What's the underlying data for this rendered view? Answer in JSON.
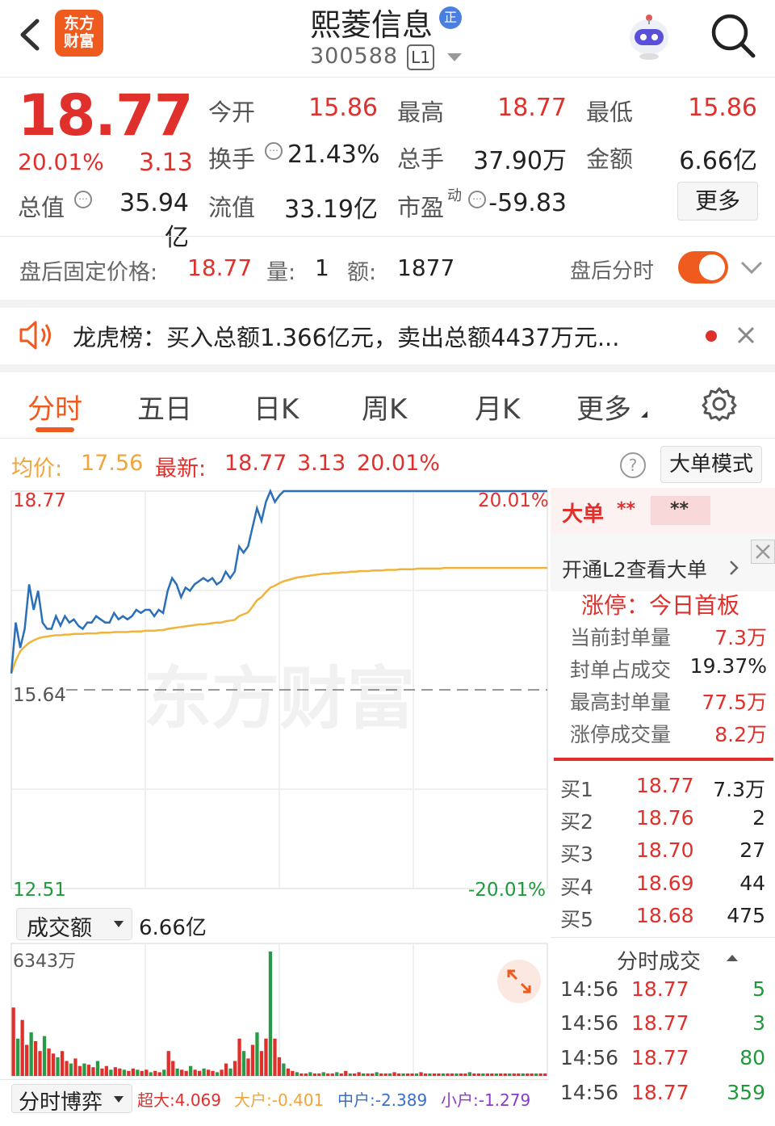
{
  "header": {
    "logo_text": "东方财富",
    "stock_name": "熙菱信息",
    "badge": "正",
    "stock_code": "300588",
    "level_badge": "L1"
  },
  "quote": {
    "price": "18.77",
    "change_pct": "20.01%",
    "change": "3.13",
    "open_label": "今开",
    "open": "15.86",
    "high_label": "最高",
    "high": "18.77",
    "low_label": "最低",
    "low": "15.86",
    "turnover_label": "换手",
    "turnover": "21.43%",
    "volume_label": "总手",
    "volume": "37.90万",
    "amount_label": "金额",
    "amount": "6.66亿",
    "mktcap_label": "总值",
    "mktcap": "35.94亿",
    "float_label": "流值",
    "float_cap": "33.19亿",
    "pe_label": "市盈",
    "pe_sup": "动",
    "pe": "-59.83",
    "more_button": "更多",
    "info_glyph": "⋯"
  },
  "after_hours": {
    "label": "盘后固定价格:",
    "price": "18.77",
    "vol_label": "量:",
    "vol": "1",
    "amt_label": "额:",
    "amt": "1877",
    "link": "盘后分时"
  },
  "dragon_tiger": {
    "text": "龙虎榜：买入总额1.366亿元，卖出总额4437万元..."
  },
  "tabs": [
    {
      "label": "分时"
    },
    {
      "label": "五日"
    },
    {
      "label": "日K"
    },
    {
      "label": "周K"
    },
    {
      "label": "月K"
    },
    {
      "label": "更多"
    }
  ],
  "avg_bar": {
    "avg_label": "均价:",
    "avg": "17.56",
    "latest_label": "最新:",
    "latest": "18.77",
    "chg": "3.13",
    "pct": "20.01%",
    "help": "?",
    "mode_button": "大单模式"
  },
  "chart_data": {
    "type": "line",
    "ylim": [
      12.51,
      18.77
    ],
    "prev_close": 15.64,
    "y_labels": {
      "top": "18.77",
      "prev": "15.64",
      "bottom": "12.51",
      "top_pct": "20.01%",
      "bottom_pct": "-20.01%"
    },
    "watermark": "东方财富",
    "series": [
      {
        "values": [
          15.9,
          16.7,
          16.3,
          16.6,
          17.3,
          16.9,
          17.2,
          16.7,
          16.6,
          16.6,
          16.8,
          16.65,
          16.8,
          16.7,
          16.75,
          16.65,
          16.6,
          16.7,
          16.7,
          16.8,
          16.75,
          16.7,
          16.7,
          16.85,
          16.75,
          16.8,
          16.75,
          16.8,
          16.9,
          16.85,
          16.9,
          16.9,
          16.8,
          16.9,
          16.85,
          17.2,
          17.4,
          17.3,
          17.1,
          17.25,
          17.2,
          17.3,
          17.35,
          17.4,
          17.35,
          17.4,
          17.3,
          17.35,
          17.5,
          17.4,
          17.5,
          17.9,
          17.8,
          17.9,
          18.2,
          18.5,
          18.3,
          18.6,
          18.77,
          18.6,
          18.7,
          18.77,
          18.77,
          18.77,
          18.77,
          18.77,
          18.77,
          18.77,
          18.77,
          18.77,
          18.77,
          18.77,
          18.77,
          18.77,
          18.77,
          18.77,
          18.77,
          18.77,
          18.77,
          18.77,
          18.77,
          18.77,
          18.77,
          18.77,
          18.77,
          18.77,
          18.77,
          18.77,
          18.77,
          18.77,
          18.77,
          18.77,
          18.77,
          18.77,
          18.77,
          18.77,
          18.77,
          18.77,
          18.77,
          18.77,
          18.77,
          18.77,
          18.77,
          18.77,
          18.77,
          18.77,
          18.77,
          18.77,
          18.77,
          18.77,
          18.77,
          18.77,
          18.77,
          18.77,
          18.77,
          18.77,
          18.77,
          18.77,
          18.77,
          18.77,
          18.77
        ]
      },
      {
        "values": [
          15.9,
          16.1,
          16.25,
          16.32,
          16.38,
          16.42,
          16.45,
          16.47,
          16.48,
          16.49,
          16.5,
          16.5,
          16.51,
          16.51,
          16.52,
          16.52,
          16.52,
          16.53,
          16.53,
          16.53,
          16.54,
          16.54,
          16.54,
          16.55,
          16.55,
          16.55,
          16.55,
          16.56,
          16.56,
          16.56,
          16.57,
          16.57,
          16.57,
          16.58,
          16.58,
          16.6,
          16.61,
          16.62,
          16.63,
          16.64,
          16.65,
          16.66,
          16.67,
          16.67,
          16.68,
          16.69,
          16.7,
          16.7,
          16.72,
          16.73,
          16.74,
          16.8,
          16.83,
          16.86,
          16.95,
          17.05,
          17.1,
          17.18,
          17.25,
          17.28,
          17.32,
          17.35,
          17.37,
          17.39,
          17.41,
          17.42,
          17.43,
          17.44,
          17.45,
          17.46,
          17.47,
          17.47,
          17.48,
          17.48,
          17.49,
          17.49,
          17.5,
          17.5,
          17.51,
          17.51,
          17.51,
          17.52,
          17.52,
          17.52,
          17.53,
          17.53,
          17.53,
          17.54,
          17.54,
          17.54,
          17.54,
          17.55,
          17.55,
          17.55,
          17.55,
          17.55,
          17.55,
          17.56,
          17.56,
          17.56,
          17.56,
          17.56,
          17.56,
          17.56,
          17.56,
          17.56,
          17.56,
          17.56,
          17.56,
          17.56,
          17.56,
          17.56,
          17.56,
          17.56,
          17.56,
          17.56,
          17.56,
          17.56,
          17.56,
          17.56,
          17.56
        ]
      }
    ]
  },
  "right_panel": {
    "big_order_label": "大单",
    "stars1": "**",
    "stars2": "**",
    "l2_text": "开通L2查看大单",
    "limit_up_label": "涨停：今日首板",
    "seal_label": "当前封单量",
    "seal": "7.3万",
    "seal_ratio_label": "封单占成交",
    "seal_ratio": "19.37%",
    "max_seal_label": "最高封单量",
    "max_seal": "77.5万",
    "limit_vol_label": "涨停成交量",
    "limit_vol": "8.2万",
    "orderbook": [
      {
        "label": "买1",
        "price": "18.77",
        "qty": "7.3万"
      },
      {
        "label": "买2",
        "price": "18.76",
        "qty": "2"
      },
      {
        "label": "买3",
        "price": "18.70",
        "qty": "27"
      },
      {
        "label": "买4",
        "price": "18.69",
        "qty": "44"
      },
      {
        "label": "买5",
        "price": "18.68",
        "qty": "475"
      }
    ],
    "ticks_label": "分时成交",
    "ticks": [
      {
        "time": "14:56",
        "price": "18.77",
        "qty": "5"
      },
      {
        "time": "14:56",
        "price": "18.77",
        "qty": "3"
      },
      {
        "time": "14:56",
        "price": "18.77",
        "qty": "80"
      },
      {
        "time": "14:56",
        "price": "18.77",
        "qty": "359"
      }
    ]
  },
  "volume": {
    "selector_label": "成交额",
    "total": "6.66亿",
    "max_label": "6343万",
    "bars": [
      0.55,
      0.3,
      0.45,
      0.25,
      0.35,
      0.28,
      0.2,
      0.32,
      0.22,
      0.18,
      0.15,
      0.2,
      0.12,
      0.1,
      0.14,
      0.08,
      0.1,
      0.09,
      0.07,
      0.12,
      0.06,
      0.08,
      0.05,
      0.07,
      0.06,
      0.05,
      0.04,
      0.06,
      0.05,
      0.04,
      0.05,
      0.03,
      0.04,
      0.03,
      0.05,
      0.2,
      0.12,
      0.06,
      0.05,
      0.04,
      0.08,
      0.05,
      0.04,
      0.06,
      0.05,
      0.04,
      0.03,
      0.05,
      0.1,
      0.06,
      0.12,
      0.3,
      0.2,
      0.14,
      0.25,
      0.35,
      0.2,
      0.3,
      1.0,
      0.3,
      0.15,
      0.1,
      0.06,
      0.04,
      0.03,
      0.02,
      0.02,
      0.03,
      0.02,
      0.02,
      0.03,
      0.02,
      0.02,
      0.03,
      0.02,
      0.04,
      0.02,
      0.02,
      0.03,
      0.02,
      0.02,
      0.02,
      0.03,
      0.02,
      0.02,
      0.02,
      0.03,
      0.02,
      0.02,
      0.02,
      0.02,
      0.02,
      0.03,
      0.02,
      0.02,
      0.02,
      0.02,
      0.02,
      0.02,
      0.02,
      0.02,
      0.02,
      0.02,
      0.03,
      0.02,
      0.02,
      0.02,
      0.02,
      0.02,
      0.02,
      0.02,
      0.02,
      0.02,
      0.02,
      0.02,
      0.02,
      0.02,
      0.02,
      0.02,
      0.02,
      0.02
    ]
  },
  "game_bar": {
    "selector_label": "分时博弈",
    "super_label": "超大:4.069",
    "big_label": "大户:-0.401",
    "mid_label": "中户:-2.389",
    "small_label": "小户:-1.279"
  }
}
